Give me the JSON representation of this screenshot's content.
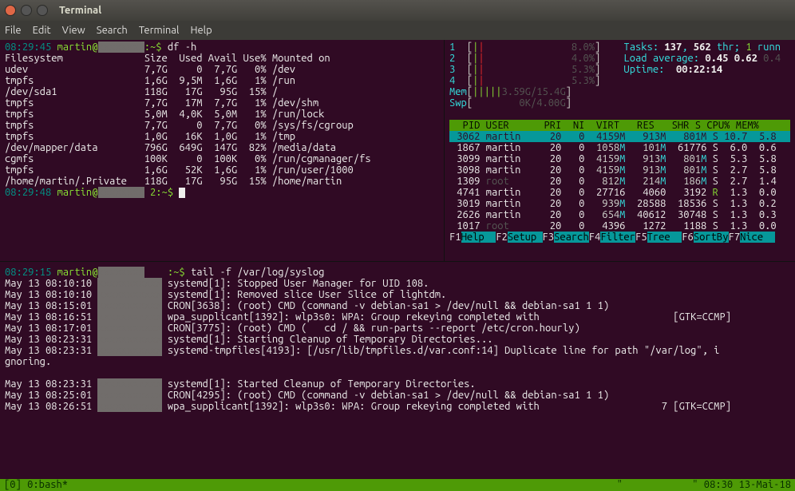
{
  "window": {
    "title": "Terminal"
  },
  "menus": [
    "File",
    "Edit",
    "View",
    "Search",
    "Terminal",
    "Help"
  ],
  "df": {
    "prompt_time1": "08:29:45",
    "prompt_user": "martin@",
    "prompt_loc": ":~$",
    "cmd": "df -h",
    "header": "Filesystem              Size  Used Avail Use% Mounted on",
    "rows": [
      [
        "udev",
        "7,7G",
        "0",
        "7,7G",
        "0%",
        "/dev"
      ],
      [
        "tmpfs",
        "1,6G",
        "9,5M",
        "1,6G",
        "1%",
        "/run"
      ],
      [
        "/dev/sda1",
        "118G",
        "17G",
        "95G",
        "15%",
        "/"
      ],
      [
        "tmpfs",
        "7,7G",
        "17M",
        "7,7G",
        "1%",
        "/dev/shm"
      ],
      [
        "tmpfs",
        "5,0M",
        "4,0K",
        "5,0M",
        "1%",
        "/run/lock"
      ],
      [
        "tmpfs",
        "7,7G",
        "0",
        "7,7G",
        "0%",
        "/sys/fs/cgroup"
      ],
      [
        "tmpfs",
        "1,0G",
        "16K",
        "1,0G",
        "1%",
        "/tmp"
      ],
      [
        "/dev/mapper/data",
        "796G",
        "649G",
        "147G",
        "82%",
        "/media/data"
      ],
      [
        "cgmfs",
        "100K",
        "0",
        "100K",
        "0%",
        "/run/cgmanager/fs"
      ],
      [
        "tmpfs",
        "1,6G",
        "52K",
        "1,6G",
        "1%",
        "/run/user/1000"
      ],
      [
        "/home/martin/.Private",
        "118G",
        "17G",
        "95G",
        "15%",
        "/home/martin"
      ]
    ],
    "prompt_time2": "08:29:48",
    "prompt_loc2": "2:~$"
  },
  "htop": {
    "cpus": [
      {
        "n": "1",
        "pct": "8.0%"
      },
      {
        "n": "2",
        "pct": "4.0%"
      },
      {
        "n": "3",
        "pct": "5.3%"
      },
      {
        "n": "4",
        "pct": "5.3%"
      }
    ],
    "mem_label": "Mem",
    "mem_used": "3.59G/15.4G",
    "swp_label": "Swp",
    "swp_used": "0K/4.00G",
    "tasks_label": "Tasks:",
    "tasks": "137",
    "thr": "562",
    "thr_label": "thr;",
    "running": "1",
    "running_label": "runn",
    "load_label": "Load average:",
    "load": [
      "0.45",
      "0.62",
      "0.4"
    ],
    "uptime_label": "Uptime:",
    "uptime": "00:22:14",
    "columns": "  PID USER      PRI  NI  VIRT   RES   SHR S CPU% MEM%",
    "procs": [
      {
        "pid": "3062",
        "user": "martin",
        "pri": "20",
        "ni": "0",
        "virt": "4159M",
        "res": "913M",
        "shr": "801M",
        "s": "S",
        "cpu": "10.7",
        "mem": "5.8",
        "sel": true
      },
      {
        "pid": "1867",
        "user": "martin",
        "pri": "20",
        "ni": "0",
        "virt": "1058M",
        "res": "101M",
        "shr": "61776",
        "s": "S",
        "cpu": "6.0",
        "mem": "0.6"
      },
      {
        "pid": "3099",
        "user": "martin",
        "pri": "20",
        "ni": "0",
        "virt": "4159M",
        "res": "913M",
        "shr": "801M",
        "s": "S",
        "cpu": "5.3",
        "mem": "5.8"
      },
      {
        "pid": "3098",
        "user": "martin",
        "pri": "20",
        "ni": "0",
        "virt": "4159M",
        "res": "913M",
        "shr": "801M",
        "s": "S",
        "cpu": "2.7",
        "mem": "5.8"
      },
      {
        "pid": "1309",
        "user": "root",
        "pri": "20",
        "ni": "0",
        "virt": "812M",
        "res": "214M",
        "shr": "186M",
        "s": "S",
        "cpu": "2.7",
        "mem": "1.4"
      },
      {
        "pid": "4741",
        "user": "martin",
        "pri": "20",
        "ni": "0",
        "virt": "27716",
        "res": "4060",
        "shr": "3192",
        "s": "R",
        "cpu": "1.3",
        "mem": "0.0"
      },
      {
        "pid": "3019",
        "user": "martin",
        "pri": "20",
        "ni": "0",
        "virt": "939M",
        "res": "28588",
        "shr": "18536",
        "s": "S",
        "cpu": "1.3",
        "mem": "0.2"
      },
      {
        "pid": "2626",
        "user": "martin",
        "pri": "20",
        "ni": "0",
        "virt": "654M",
        "res": "40612",
        "shr": "30748",
        "s": "S",
        "cpu": "1.3",
        "mem": "0.3"
      },
      {
        "pid": "1017",
        "user": "root",
        "pri": "20",
        "ni": "0",
        "virt": "4396",
        "res": "1272",
        "shr": "1188",
        "s": "S",
        "cpu": "1.3",
        "mem": "0.0"
      }
    ],
    "fkeys": [
      [
        "F1",
        "Help"
      ],
      [
        "F2",
        "Setup"
      ],
      [
        "F3",
        "Search"
      ],
      [
        "F4",
        "Filter"
      ],
      [
        "F5",
        "Tree"
      ],
      [
        "F6",
        "SortBy"
      ],
      [
        "F7",
        "Nice"
      ]
    ]
  },
  "log": {
    "prompt_time": "08:29:15",
    "prompt_user": "martin@",
    "prompt_loc": ":~$",
    "cmd": "tail -f /var/log/syslog",
    "lines": [
      "May 13 08:10:10             systemd[1]: Stopped User Manager for UID 108.",
      "May 13 08:10:10             systemd[1]: Removed slice User Slice of lightdm.",
      "May 13 08:15:01             CRON[3638]: (root) CMD (command -v debian-sa1 > /dev/null && debian-sa1 1 1)",
      "May 13 08:16:51             wpa_supplicant[1392]: wlp3s0: WPA: Group rekeying completed with                       [GTK=CCMP]",
      "May 13 08:17:01             CRON[3775]: (root) CMD (   cd / && run-parts --report /etc/cron.hourly)",
      "May 13 08:23:31             systemd[1]: Starting Cleanup of Temporary Directories...",
      "May 13 08:23:31             systemd-tmpfiles[4193]: [/usr/lib/tmpfiles.d/var.conf:14] Duplicate line for path \"/var/log\", i",
      "gnoring.",
      "",
      "May 13 08:23:31             systemd[1]: Started Cleanup of Temporary Directories.",
      "May 13 08:25:01             CRON[4295]: (root) CMD (command -v debian-sa1 > /dev/null && debian-sa1 1 1)",
      "May 13 08:26:51             wpa_supplicant[1392]: wlp3s0: WPA: Group rekeying completed with                     7 [GTK=CCMP]"
    ]
  },
  "statusbar": {
    "left": "[0] 0:bash*",
    "right": "\"            \" 08:30 13-Mai-18"
  }
}
